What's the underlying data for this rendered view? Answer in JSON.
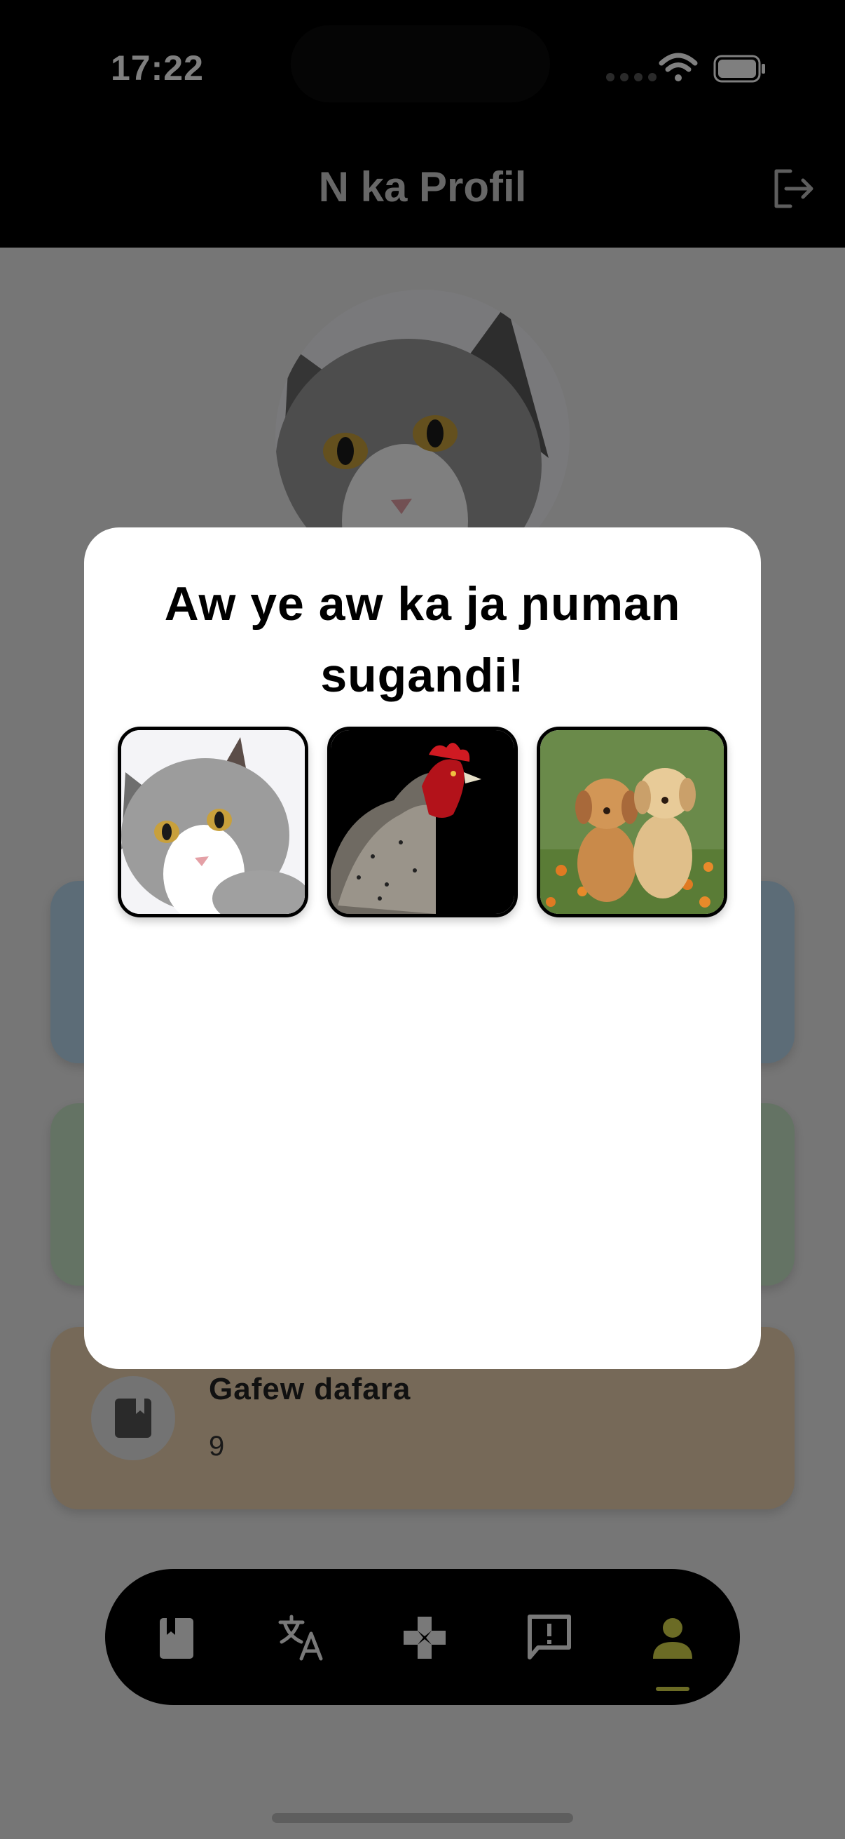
{
  "status_bar": {
    "time": "17:22"
  },
  "header": {
    "title": "N ka Profil",
    "logout_icon": "logout-icon"
  },
  "profile": {
    "avatar_icon": "cat-avatar"
  },
  "cards": [
    {
      "name": "card-blue",
      "color": "#b9d9ee"
    },
    {
      "name": "card-green",
      "color": "#c9e6c8"
    },
    {
      "name": "card-tan",
      "color": "#ecd3b1",
      "icon": "book-icon",
      "title": "Gafew dafara",
      "value": "9"
    }
  ],
  "modal": {
    "title": "Aw ye aw ka ja ɲuman sugandi!",
    "options": [
      {
        "name": "cat-option",
        "icon": "cat-image"
      },
      {
        "name": "chicken-option",
        "icon": "chicken-image"
      },
      {
        "name": "puppies-option",
        "icon": "puppies-image"
      }
    ]
  },
  "nav": {
    "items": [
      {
        "icon": "book-icon"
      },
      {
        "icon": "translate-icon"
      },
      {
        "icon": "gamepad-icon"
      },
      {
        "icon": "feedback-icon"
      },
      {
        "icon": "profile-icon",
        "active": true
      }
    ],
    "active_color": "#d6d64a"
  }
}
